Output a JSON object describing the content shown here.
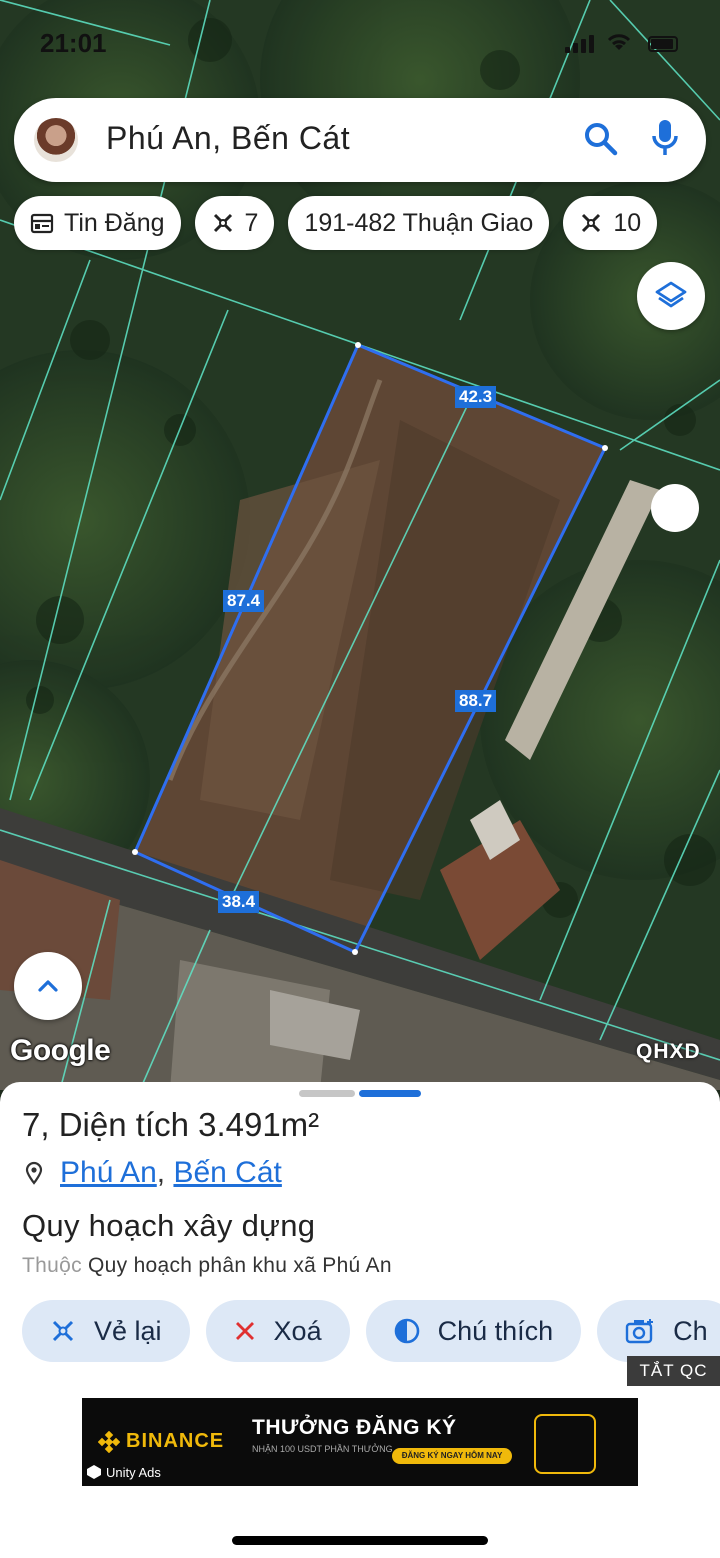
{
  "status_bar": {
    "time": "21:01"
  },
  "search": {
    "query": "Phú An, Bến Cát"
  },
  "chips": [
    {
      "icon": "calendar-icon",
      "label": "Tin Đăng"
    },
    {
      "icon": "draw-icon",
      "label": "7"
    },
    {
      "icon": "",
      "label": "191-482 Thuận Giao"
    },
    {
      "icon": "draw-icon",
      "label": "10"
    }
  ],
  "map": {
    "measurements": {
      "top": "42.3",
      "left": "87.4",
      "right": "88.7",
      "bottom": "38.4"
    },
    "attribution": "Google",
    "layer_label": "QHXD"
  },
  "sheet": {
    "title": "7, Diện tích 3.491m²",
    "location": {
      "commune": "Phú An",
      "separator": ",",
      "district": "Bến Cát"
    },
    "planning_title": "Quy hoạch xây dựng",
    "planning_prefix": "Thuộc",
    "planning_name": "Quy hoạch phân khu xã Phú An",
    "actions": [
      {
        "icon": "redraw-icon",
        "label": "Vẻ lại"
      },
      {
        "icon": "close-icon",
        "label": "Xoá"
      },
      {
        "icon": "contrast-icon",
        "label": "Chú thích"
      },
      {
        "icon": "camera-icon",
        "label": "Ch"
      }
    ],
    "ad_close": "TẮT QC"
  },
  "ad": {
    "brand": "BINANCE",
    "headline": "THƯỞNG ĐĂNG KÝ",
    "subline": "NHẬN 100 USDT PHẦN THƯỞNG",
    "cta": "ĐĂNG KÝ NGAY HÔM NAY",
    "network": "Unity Ads"
  },
  "colors": {
    "accent": "#1e6fd9",
    "chip_bg": "#ffffff",
    "action_bg": "#dde8f6",
    "parcel_lines": "#5fe6c8"
  }
}
